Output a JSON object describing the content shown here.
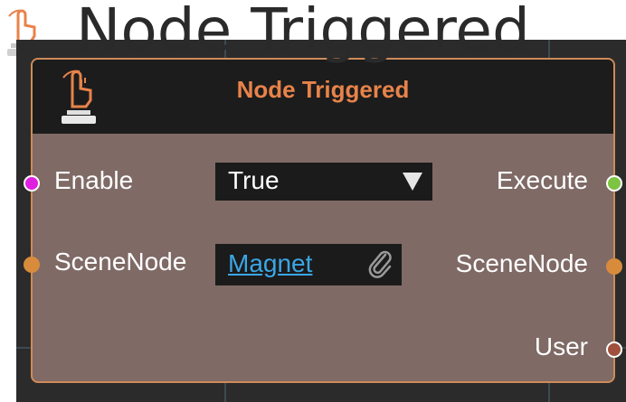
{
  "overlay": {
    "title": "Node Triggered",
    "icon": "trigger-hand-icon"
  },
  "node": {
    "title": "Node Triggered",
    "icon": "trigger-hand-icon",
    "colors": {
      "title": "#e8834a",
      "border": "#cf8a58",
      "body": "#7f6a66",
      "header": "#1c1c1c"
    },
    "inputs": [
      {
        "label": "Enable",
        "pin_color": "#e020e0"
      },
      {
        "label": "SceneNode",
        "pin_color": "#d98b3c"
      }
    ],
    "outputs": [
      {
        "label": "Execute",
        "pin_color": "#7dc443"
      },
      {
        "label": "SceneNode",
        "pin_color": "#d98b3c"
      },
      {
        "label": "User",
        "pin_color": "#a0503c"
      }
    ],
    "enable_dropdown": {
      "value": "True",
      "icon": "dropdown-arrow-icon"
    },
    "scene_node_ref": {
      "value": "Magnet",
      "icon": "paperclip-icon"
    }
  }
}
